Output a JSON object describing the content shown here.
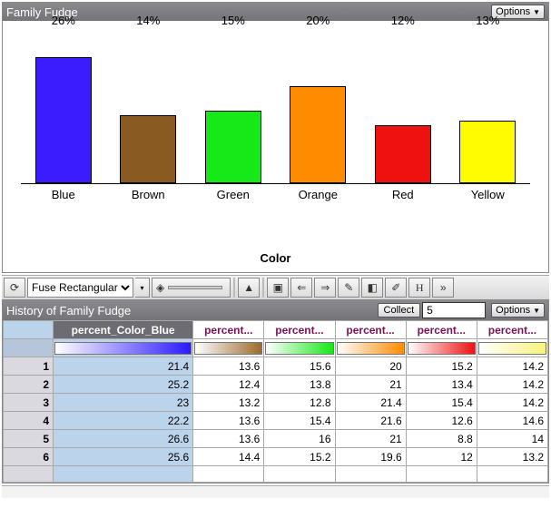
{
  "chart_panel": {
    "title": "Family Fudge",
    "options_label": "Options",
    "axis_title": "Color"
  },
  "chart_data": {
    "type": "bar",
    "title": "Family Fudge",
    "xlabel": "Color",
    "ylabel": "",
    "ylim": [
      0,
      30
    ],
    "categories": [
      "Blue",
      "Brown",
      "Green",
      "Red",
      "Orange",
      "Red",
      "Yellow"
    ],
    "series": [
      {
        "name": "Blue",
        "value": 26,
        "label": "26%",
        "color": "#3b1cff"
      },
      {
        "name": "Brown",
        "value": 14,
        "label": "14%",
        "color": "#8a5a23"
      },
      {
        "name": "Green",
        "value": 15,
        "label": "15%",
        "color": "#17e817"
      },
      {
        "name": "Orange",
        "value": 20,
        "label": "20%",
        "color": "#ff8c00"
      },
      {
        "name": "Red",
        "value": 12,
        "label": "12%",
        "color": "#ef1010"
      },
      {
        "name": "Yellow",
        "value": 13,
        "label": "13%",
        "color": "#fffb00"
      }
    ]
  },
  "toolbar": {
    "refresh_icon": "refresh-icon",
    "mode_select": "Fuse Rectangular",
    "tools": [
      "arrow-icon",
      "cube-icon",
      "back-icon",
      "forward-icon",
      "pencil-icon",
      "eraser-icon",
      "brush-icon",
      "text-icon",
      "more-icon"
    ]
  },
  "history_panel": {
    "title": "History of Family Fudge",
    "collect_label": "Collect",
    "collect_value": "5",
    "options_label": "Options",
    "columns": [
      {
        "key": "blue",
        "label": "percent_Color_Blue",
        "grad": [
          "#ffffff",
          "#2a1aff"
        ],
        "main": true
      },
      {
        "key": "brown",
        "label": "percent...",
        "grad": [
          "#ffffff",
          "#9d6a2e"
        ]
      },
      {
        "key": "green",
        "label": "percent...",
        "grad": [
          "#ffffff",
          "#17e817"
        ]
      },
      {
        "key": "orange",
        "label": "percent...",
        "grad": [
          "#ffffff",
          "#ff8c00"
        ]
      },
      {
        "key": "red",
        "label": "percent...",
        "grad": [
          "#ffffff",
          "#ef1010"
        ]
      },
      {
        "key": "yellow",
        "label": "percent...",
        "grad": [
          "#ffffff",
          "#f7f37a"
        ]
      }
    ],
    "rows": [
      {
        "n": "1",
        "blue": "21.4",
        "brown": "13.6",
        "green": "15.6",
        "orange": "20",
        "red": "15.2",
        "yellow": "14.2"
      },
      {
        "n": "2",
        "blue": "25.2",
        "brown": "12.4",
        "green": "13.8",
        "orange": "21",
        "red": "13.4",
        "yellow": "14.2"
      },
      {
        "n": "3",
        "blue": "23",
        "brown": "13.2",
        "green": "12.8",
        "orange": "21.4",
        "red": "15.4",
        "yellow": "14.2"
      },
      {
        "n": "4",
        "blue": "22.2",
        "brown": "13.6",
        "green": "15.4",
        "orange": "21.6",
        "red": "12.6",
        "yellow": "14.6"
      },
      {
        "n": "5",
        "blue": "26.6",
        "brown": "13.6",
        "green": "16",
        "orange": "21",
        "red": "8.8",
        "yellow": "14"
      },
      {
        "n": "6",
        "blue": "25.6",
        "brown": "14.4",
        "green": "15.2",
        "orange": "19.6",
        "red": "12",
        "yellow": "13.2"
      }
    ]
  }
}
